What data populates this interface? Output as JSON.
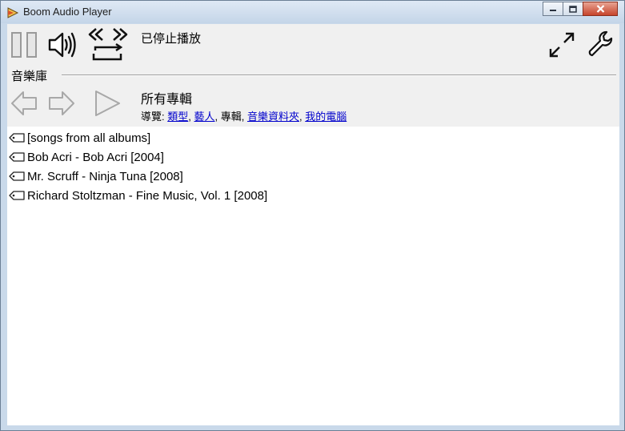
{
  "window": {
    "title": "Boom Audio Player"
  },
  "status": {
    "text": "已停止播放"
  },
  "library": {
    "label": "音樂庫"
  },
  "heading": "所有專輯",
  "nav": {
    "prefix": "導覽: ",
    "sep": ", ",
    "genre": "類型",
    "artist": "藝人",
    "album": "專輯",
    "folder": "音樂資料夾",
    "computer": "我的電腦"
  },
  "albums": [
    "[songs from all albums]",
    "Bob Acri - Bob Acri [2004]",
    "Mr. Scruff - Ninja Tuna [2008]",
    "Richard Stoltzman - Fine Music, Vol. 1 [2008]"
  ],
  "icons": {
    "pause": "pause-icon",
    "volume": "speaker-icon",
    "repeat": "repeat-icon",
    "fullscreen": "expand-icon",
    "settings": "wrench-icon",
    "back": "arrow-left-icon",
    "forward": "arrow-right-icon",
    "play": "play-icon"
  }
}
